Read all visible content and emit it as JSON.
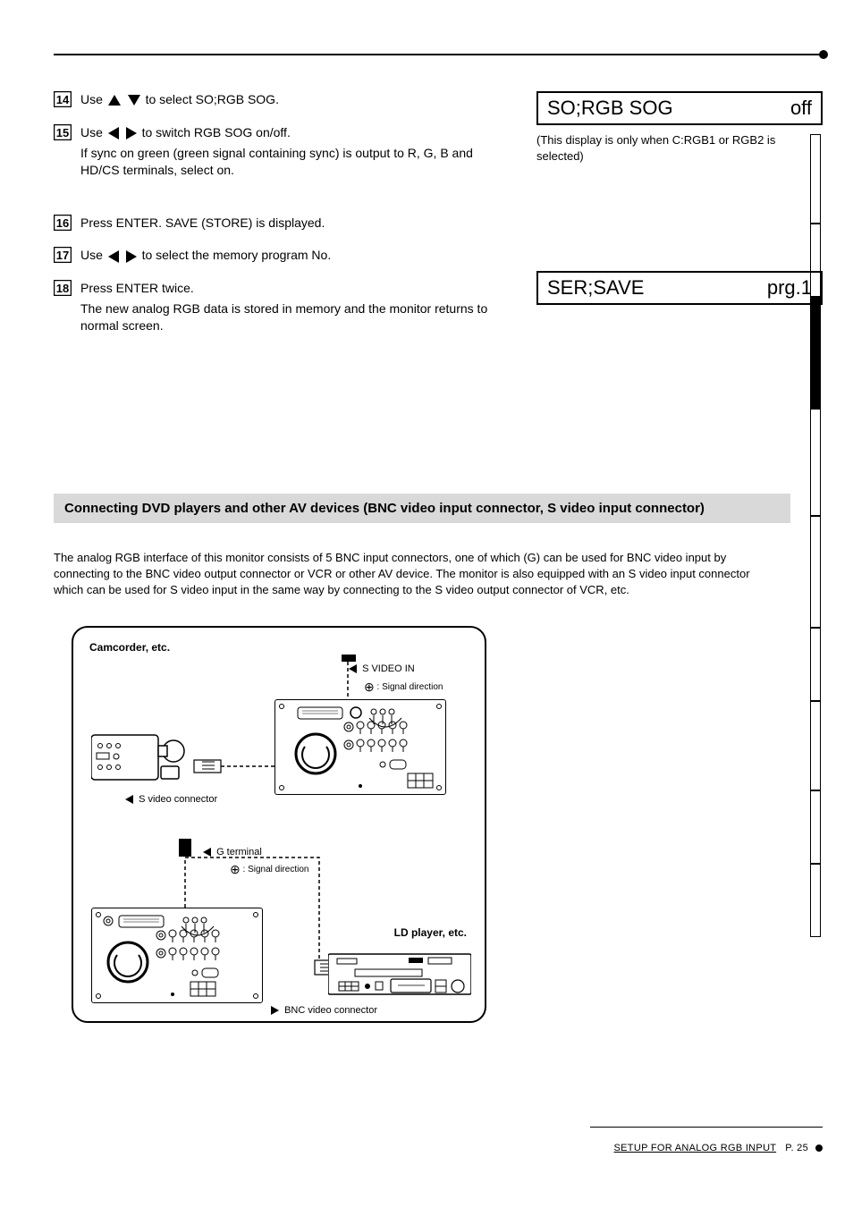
{
  "steps": {
    "s14": {
      "pre": "Use ",
      "post": " to select SO;RGB SOG."
    },
    "s15": {
      "pre": "Use ",
      "post": " to switch RGB SOG on/off.",
      "note": "If sync on green (green signal containing sync) is output to R, G, B and HD/CS terminals, select on."
    },
    "s16": {
      "text": "Press ENTER. SAVE (STORE) is displayed."
    },
    "s17": {
      "pre": "Use ",
      "post": " to select the memory program No."
    },
    "s18": {
      "text": "Press ENTER twice.",
      "note": "The new analog RGB data is stored in memory and the monitor returns to normal screen."
    }
  },
  "lcd": {
    "box1_left": "SO;RGB SOG",
    "box1_right": "off",
    "note1": "(This display is only when C:RGB1 or RGB2 is selected)",
    "box2_left": "SER;SAVE",
    "box2_right": "prg.1"
  },
  "section": {
    "title": "Connecting DVD players and other AV devices (BNC video input connector, S video input connector)",
    "note": "The analog RGB interface of this monitor consists of 5 BNC input connectors, one of which (G) can be used for BNC video input by connecting to the BNC video output connector or VCR or other AV device. The monitor is also equipped with an S video input connector which can be used for S video input in the same way by connecting to the S video output connector of VCR, etc."
  },
  "diagram": {
    "camcorder": "Camcorder, etc.",
    "svideo_conn": "S video connector",
    "svideo_in": "S VIDEO IN",
    "ld": "LD player, etc.",
    "bnc_conn": "BNC video connector",
    "g_terminal": "G terminal",
    "sig_arrow": ": Signal direction"
  },
  "tabs": [
    "",
    "",
    "",
    "",
    "",
    "",
    "",
    "",
    ""
  ],
  "footer": {
    "left": "SETUP FOR ANALOG RGB INPUT",
    "right": "P. 25"
  }
}
